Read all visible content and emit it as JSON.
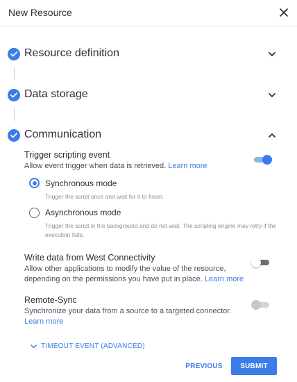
{
  "dialog": {
    "title": "New Resource",
    "close_icon": "close-icon"
  },
  "steps": [
    {
      "title": "Resource definition",
      "completed": true,
      "expanded": false
    },
    {
      "title": "Data storage",
      "completed": true,
      "expanded": false
    },
    {
      "title": "Communication",
      "completed": true,
      "expanded": true
    }
  ],
  "communication": {
    "trigger": {
      "title": "Trigger scripting event",
      "description": "Allow event trigger when data is retrieved.",
      "link": "Learn more",
      "enabled": true
    },
    "modes": [
      {
        "label": "Synchronous mode",
        "hint": "Trigger the script once and wait for it to finish.",
        "selected": true
      },
      {
        "label": "Asynchronous mode",
        "hint": "Trigger the script in the background and do not wait. The scripting engine may retry if the execution fails.",
        "selected": false
      }
    ],
    "write_data": {
      "title": "Write data from West Connectivity",
      "description": "Allow other applications to modify the value of the resource, depending on the permissions you have put in place.",
      "link": "Learn more",
      "enabled": false
    },
    "remote_sync": {
      "title": "Remote-Sync",
      "description": "Synchronize your data from a source to a targeted connector.",
      "link": "Learn more",
      "enabled": false,
      "disabled": true
    }
  },
  "advanced": {
    "label": "TIMEOUT EVENT (ADVANCED)"
  },
  "footer": {
    "previous_label": "PREVIOUS",
    "submit_label": "SUBMIT"
  },
  "colors": {
    "accent": "#3b7de8",
    "toggle_on_track": "#8ab3f2",
    "toggle_off_track": "#6b6f76",
    "toggle_disabled": "#d3d5d9"
  }
}
